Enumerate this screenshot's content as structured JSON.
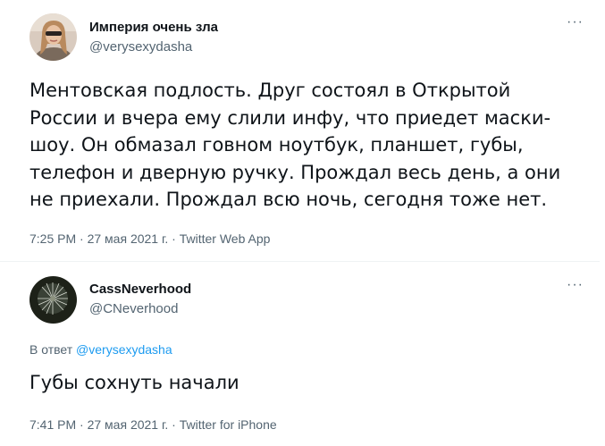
{
  "tweets": [
    {
      "author": {
        "display_name": "Империя очень зла",
        "handle": "@verysexydasha",
        "avatar": "portrait-avatar"
      },
      "more_label": "···",
      "text": "Ментовская подлость. Друг состоял в Открытой\nРоссии и вчера ему слили инфу, что приедет маски-\nшоу. Он обмазал говном ноутбук, планшет, губы,\nтелефон и дверную ручку. Прождал весь день, а они\nне приехали. Прождал всю ночь, сегодня тоже нет.",
      "time": "7:25 PM",
      "date": "27 мая 2021 г.",
      "source": "Twitter Web App",
      "separator": "·"
    },
    {
      "author": {
        "display_name": "CassNeverhood",
        "handle": "@CNeverhood",
        "avatar": "dandelion-avatar"
      },
      "more_label": "···",
      "reply_prefix": "В ответ",
      "reply_to": "@verysexydasha",
      "text": "Губы сохнуть начали",
      "time": "7:41 PM",
      "date": "27 мая 2021 г.",
      "source": "Twitter for iPhone",
      "separator": "·"
    }
  ],
  "colors": {
    "text": "#0f1419",
    "secondary": "#536471",
    "link": "#1d9bf0",
    "divider": "#eff3f4"
  }
}
